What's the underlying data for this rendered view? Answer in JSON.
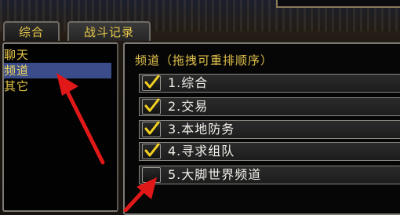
{
  "tabs": [
    {
      "label": "综合"
    },
    {
      "label": "战斗记录"
    }
  ],
  "sidebar": {
    "items": [
      {
        "label": "聊天"
      },
      {
        "label": "频道"
      },
      {
        "label": "其它"
      }
    ],
    "selected": "频道"
  },
  "channels": {
    "title": "频道（拖拽可重排顺序）",
    "items": [
      {
        "label": "1.综合",
        "checked": true
      },
      {
        "label": "2.交易",
        "checked": true
      },
      {
        "label": "3.本地防务",
        "checked": true
      },
      {
        "label": "4.寻求组队",
        "checked": true
      },
      {
        "label": "5.大脚世界频道",
        "checked": false
      }
    ]
  },
  "colors": {
    "accent_text": "#e8c84a",
    "selection": "#3a4c8a",
    "arrow": "#e01818"
  }
}
